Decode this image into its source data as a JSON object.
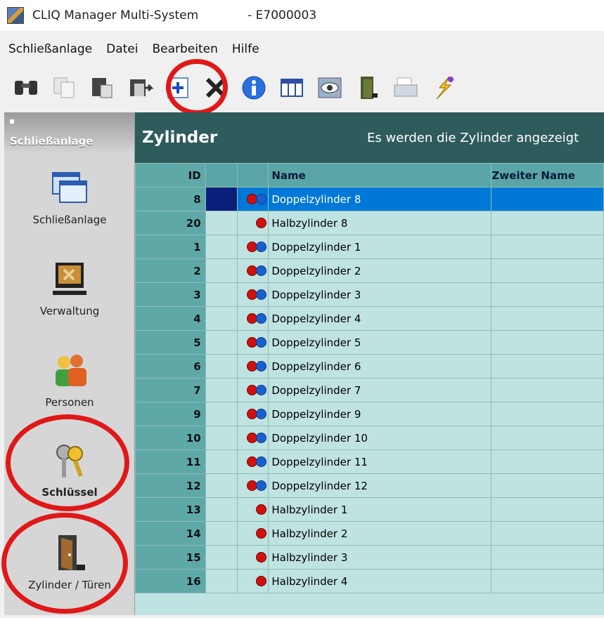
{
  "window": {
    "title": "CLIQ Manager Multi-System",
    "system": "- E7000003"
  },
  "menu": [
    "Schließanlage",
    "Datei",
    "Bearbeiten",
    "Hilfe"
  ],
  "toolbar": [
    {
      "name": "find-icon"
    },
    {
      "name": "copy-icon"
    },
    {
      "name": "paste-icon"
    },
    {
      "name": "export-icon"
    },
    {
      "name": "add-icon"
    },
    {
      "name": "delete-icon"
    },
    {
      "name": "info-icon"
    },
    {
      "name": "table-icon"
    },
    {
      "name": "view-icon"
    },
    {
      "name": "door-icon"
    },
    {
      "name": "print-icon"
    },
    {
      "name": "program-icon"
    }
  ],
  "sidebar": {
    "header": "Schließanlage",
    "items": [
      {
        "label": "Schließanlage",
        "icon": "windows-icon"
      },
      {
        "label": "Verwaltung",
        "icon": "admin-monitor-icon"
      },
      {
        "label": "Personen",
        "icon": "persons-icon"
      },
      {
        "label": "Schlüssel",
        "icon": "keys-icon"
      },
      {
        "label": "Zylinder / Türen",
        "icon": "door-icon"
      }
    ]
  },
  "panel": {
    "title": "Zylinder",
    "subtitle": "Es werden die Zylinder angezeigt",
    "columns": {
      "id": "ID",
      "name": "Name",
      "second": "Zweiter Name"
    },
    "rows": [
      {
        "id": "8",
        "name": "Doppelzylinder 8",
        "type": "double",
        "selected": true
      },
      {
        "id": "20",
        "name": "Halbzylinder 8",
        "type": "half"
      },
      {
        "id": "1",
        "name": "Doppelzylinder 1",
        "type": "double"
      },
      {
        "id": "2",
        "name": "Doppelzylinder 2",
        "type": "double"
      },
      {
        "id": "3",
        "name": "Doppelzylinder 3",
        "type": "double"
      },
      {
        "id": "4",
        "name": "Doppelzylinder 4",
        "type": "double"
      },
      {
        "id": "5",
        "name": "Doppelzylinder 5",
        "type": "double"
      },
      {
        "id": "6",
        "name": "Doppelzylinder 6",
        "type": "double"
      },
      {
        "id": "7",
        "name": "Doppelzylinder 7",
        "type": "double"
      },
      {
        "id": "9",
        "name": "Doppelzylinder 9",
        "type": "double"
      },
      {
        "id": "10",
        "name": "Doppelzylinder 10",
        "type": "double"
      },
      {
        "id": "11",
        "name": "Doppelzylinder 11",
        "type": "double"
      },
      {
        "id": "12",
        "name": "Doppelzylinder 12",
        "type": "double"
      },
      {
        "id": "13",
        "name": "Halbzylinder 1",
        "type": "half"
      },
      {
        "id": "14",
        "name": "Halbzylinder 2",
        "type": "half"
      },
      {
        "id": "15",
        "name": "Halbzylinder 3",
        "type": "half"
      },
      {
        "id": "16",
        "name": "Halbzylinder 4",
        "type": "half"
      }
    ]
  },
  "colors": {
    "header": "#2e5b5b",
    "row": "#bfe3e0",
    "id_col": "#5fa8a8",
    "selected": "#0078d7",
    "highlight_ring": "#e01818"
  }
}
